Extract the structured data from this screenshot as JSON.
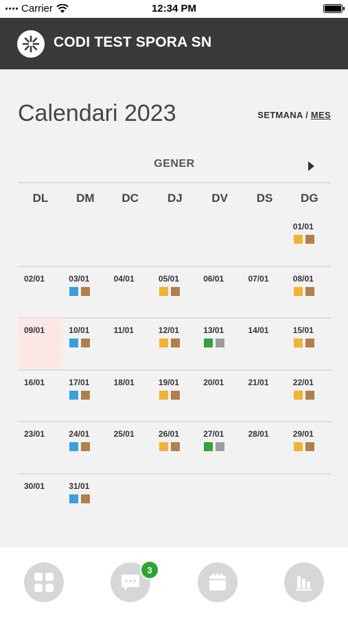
{
  "status_bar": {
    "carrier": "Carrier",
    "time": "12:34 PM"
  },
  "app": {
    "title": "CODI TEST SPORA SN"
  },
  "calendar": {
    "title": "Calendari 2023",
    "view_week": "SETMANA",
    "view_separator": "/",
    "view_month": "MES",
    "month": "GENER",
    "weekdays": [
      "DL",
      "DM",
      "DC",
      "DJ",
      "DV",
      "DS",
      "DG"
    ],
    "today": "09/01",
    "weeks": [
      [
        null,
        null,
        null,
        null,
        null,
        null,
        {
          "date": "01/01",
          "marks": [
            "yellow",
            "brown"
          ]
        }
      ],
      [
        {
          "date": "02/01",
          "marks": []
        },
        {
          "date": "03/01",
          "marks": [
            "blue",
            "brown"
          ]
        },
        {
          "date": "04/01",
          "marks": []
        },
        {
          "date": "05/01",
          "marks": [
            "yellow",
            "brown"
          ]
        },
        {
          "date": "06/01",
          "marks": []
        },
        {
          "date": "07/01",
          "marks": []
        },
        {
          "date": "08/01",
          "marks": [
            "yellow",
            "brown"
          ]
        }
      ],
      [
        {
          "date": "09/01",
          "marks": []
        },
        {
          "date": "10/01",
          "marks": [
            "blue",
            "brown"
          ]
        },
        {
          "date": "11/01",
          "marks": []
        },
        {
          "date": "12/01",
          "marks": [
            "yellow",
            "brown"
          ]
        },
        {
          "date": "13/01",
          "marks": [
            "green",
            "gray"
          ]
        },
        {
          "date": "14/01",
          "marks": []
        },
        {
          "date": "15/01",
          "marks": [
            "yellow",
            "brown"
          ]
        }
      ],
      [
        {
          "date": "16/01",
          "marks": []
        },
        {
          "date": "17/01",
          "marks": [
            "blue",
            "brown"
          ]
        },
        {
          "date": "18/01",
          "marks": []
        },
        {
          "date": "19/01",
          "marks": [
            "yellow",
            "brown"
          ]
        },
        {
          "date": "20/01",
          "marks": []
        },
        {
          "date": "21/01",
          "marks": []
        },
        {
          "date": "22/01",
          "marks": [
            "yellow",
            "brown"
          ]
        }
      ],
      [
        {
          "date": "23/01",
          "marks": []
        },
        {
          "date": "24/01",
          "marks": [
            "blue",
            "brown"
          ]
        },
        {
          "date": "25/01",
          "marks": []
        },
        {
          "date": "26/01",
          "marks": [
            "yellow",
            "brown"
          ]
        },
        {
          "date": "27/01",
          "marks": [
            "green",
            "gray"
          ]
        },
        {
          "date": "28/01",
          "marks": []
        },
        {
          "date": "29/01",
          "marks": [
            "yellow",
            "brown"
          ]
        }
      ],
      [
        {
          "date": "30/01",
          "marks": []
        },
        {
          "date": "31/01",
          "marks": [
            "blue",
            "brown"
          ]
        },
        null,
        null,
        null,
        null,
        null
      ]
    ]
  },
  "mark_colors": {
    "blue": "#3a9fdc",
    "brown": "#b07f4a",
    "yellow": "#f2b233",
    "green": "#35a23a",
    "gray": "#9d9d9d"
  },
  "tabbar": {
    "tabs": [
      {
        "name": "tab-dashboard",
        "icon": "grid-icon"
      },
      {
        "name": "tab-messages",
        "icon": "chat-icon"
      },
      {
        "name": "tab-calendar",
        "icon": "calendar-icon"
      },
      {
        "name": "tab-stats",
        "icon": "bar-chart-icon"
      }
    ],
    "messages_badge": "3"
  },
  "colors": {
    "appbar": "#3a3a3a",
    "today_highlight": "#fde7e7",
    "badge": "#2fa52f"
  }
}
